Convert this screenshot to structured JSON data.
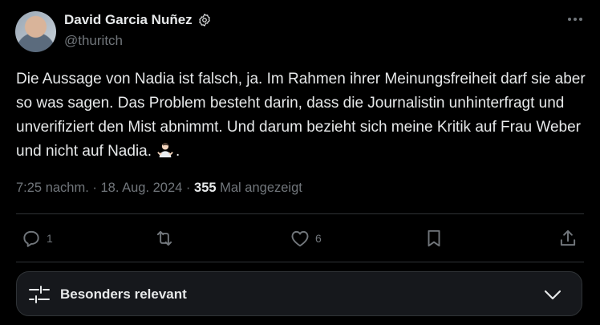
{
  "author": {
    "display_name": "David Garcia Nuñez",
    "handle": "@thuritch",
    "badge_icon": "verified-badge-icon"
  },
  "tweet": {
    "text": "Die Aussage von Nadia ist falsch, ja. Im Rahmen ihrer Meinungsfreiheit darf sie aber so was sagen. Das Problem besteht darin, dass die Journalistin unhinterfragt und unverifiziert den Mist abnimmt. Und darum bezieht sich meine Kritik auf Frau Weber und nicht auf Nadia.",
    "trailing_emoji_icon": "person-shrugging-emoji-icon",
    "trailing_text": "."
  },
  "meta": {
    "time": "7:25 nachm.",
    "sep1": " · ",
    "date": "18. Aug. 2024",
    "sep2": " · ",
    "views_count": "355",
    "views_label": " Mal angezeigt"
  },
  "actions": {
    "reply_count": "1",
    "retweet_count": "",
    "like_count": "6"
  },
  "sort": {
    "label": "Besonders relevant"
  },
  "colors": {
    "background": "#000000",
    "text_primary": "#e7e9ea",
    "text_secondary": "#71767b",
    "border": "#2f3336"
  }
}
